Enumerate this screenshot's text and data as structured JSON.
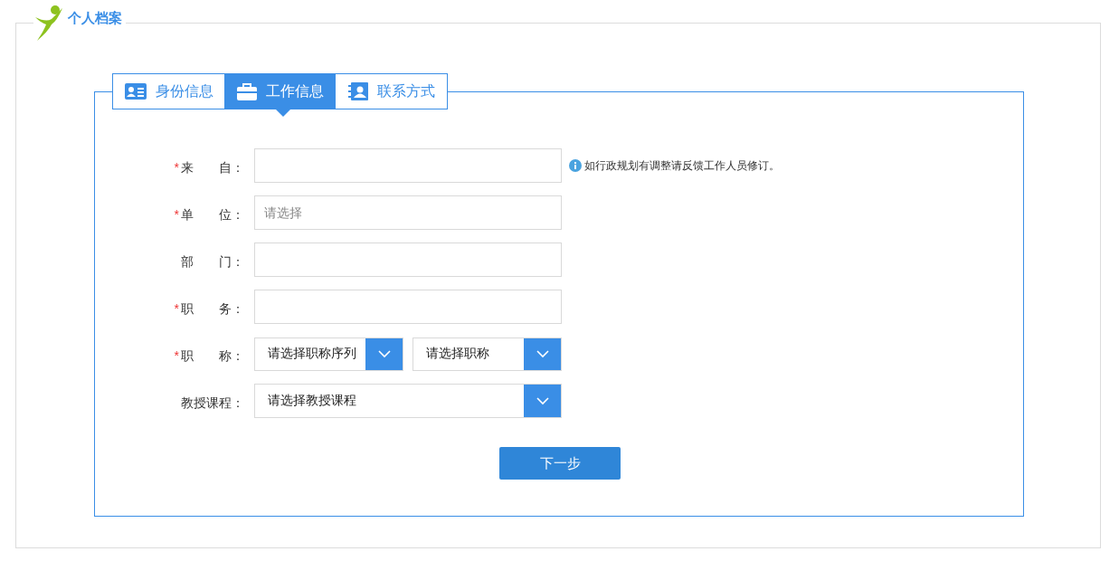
{
  "section_title": "个人档案",
  "tabs": [
    {
      "label": "身份信息",
      "selected": false
    },
    {
      "label": "工作信息",
      "selected": true
    },
    {
      "label": "联系方式",
      "selected": false
    }
  ],
  "fields": [
    {
      "required_mark": "*",
      "label": "来　　自：",
      "kind": "text",
      "hint": "如行政规划有调整请反馈工作人员修订。"
    },
    {
      "required_mark": "*",
      "label": "单　　位：",
      "kind": "text",
      "placeholder": "请选择"
    },
    {
      "label": "部　　门：",
      "kind": "text"
    },
    {
      "required_mark": "*",
      "label": "职　　务：",
      "kind": "text"
    },
    {
      "required_mark": "*",
      "label": "职　　称：",
      "kind": "select-pair",
      "options": [
        "请选择职称序列",
        "请选择职称"
      ]
    },
    {
      "label": "教授课程：",
      "kind": "select",
      "options": [
        "请选择教授课程"
      ]
    }
  ],
  "next_button": "下一步"
}
